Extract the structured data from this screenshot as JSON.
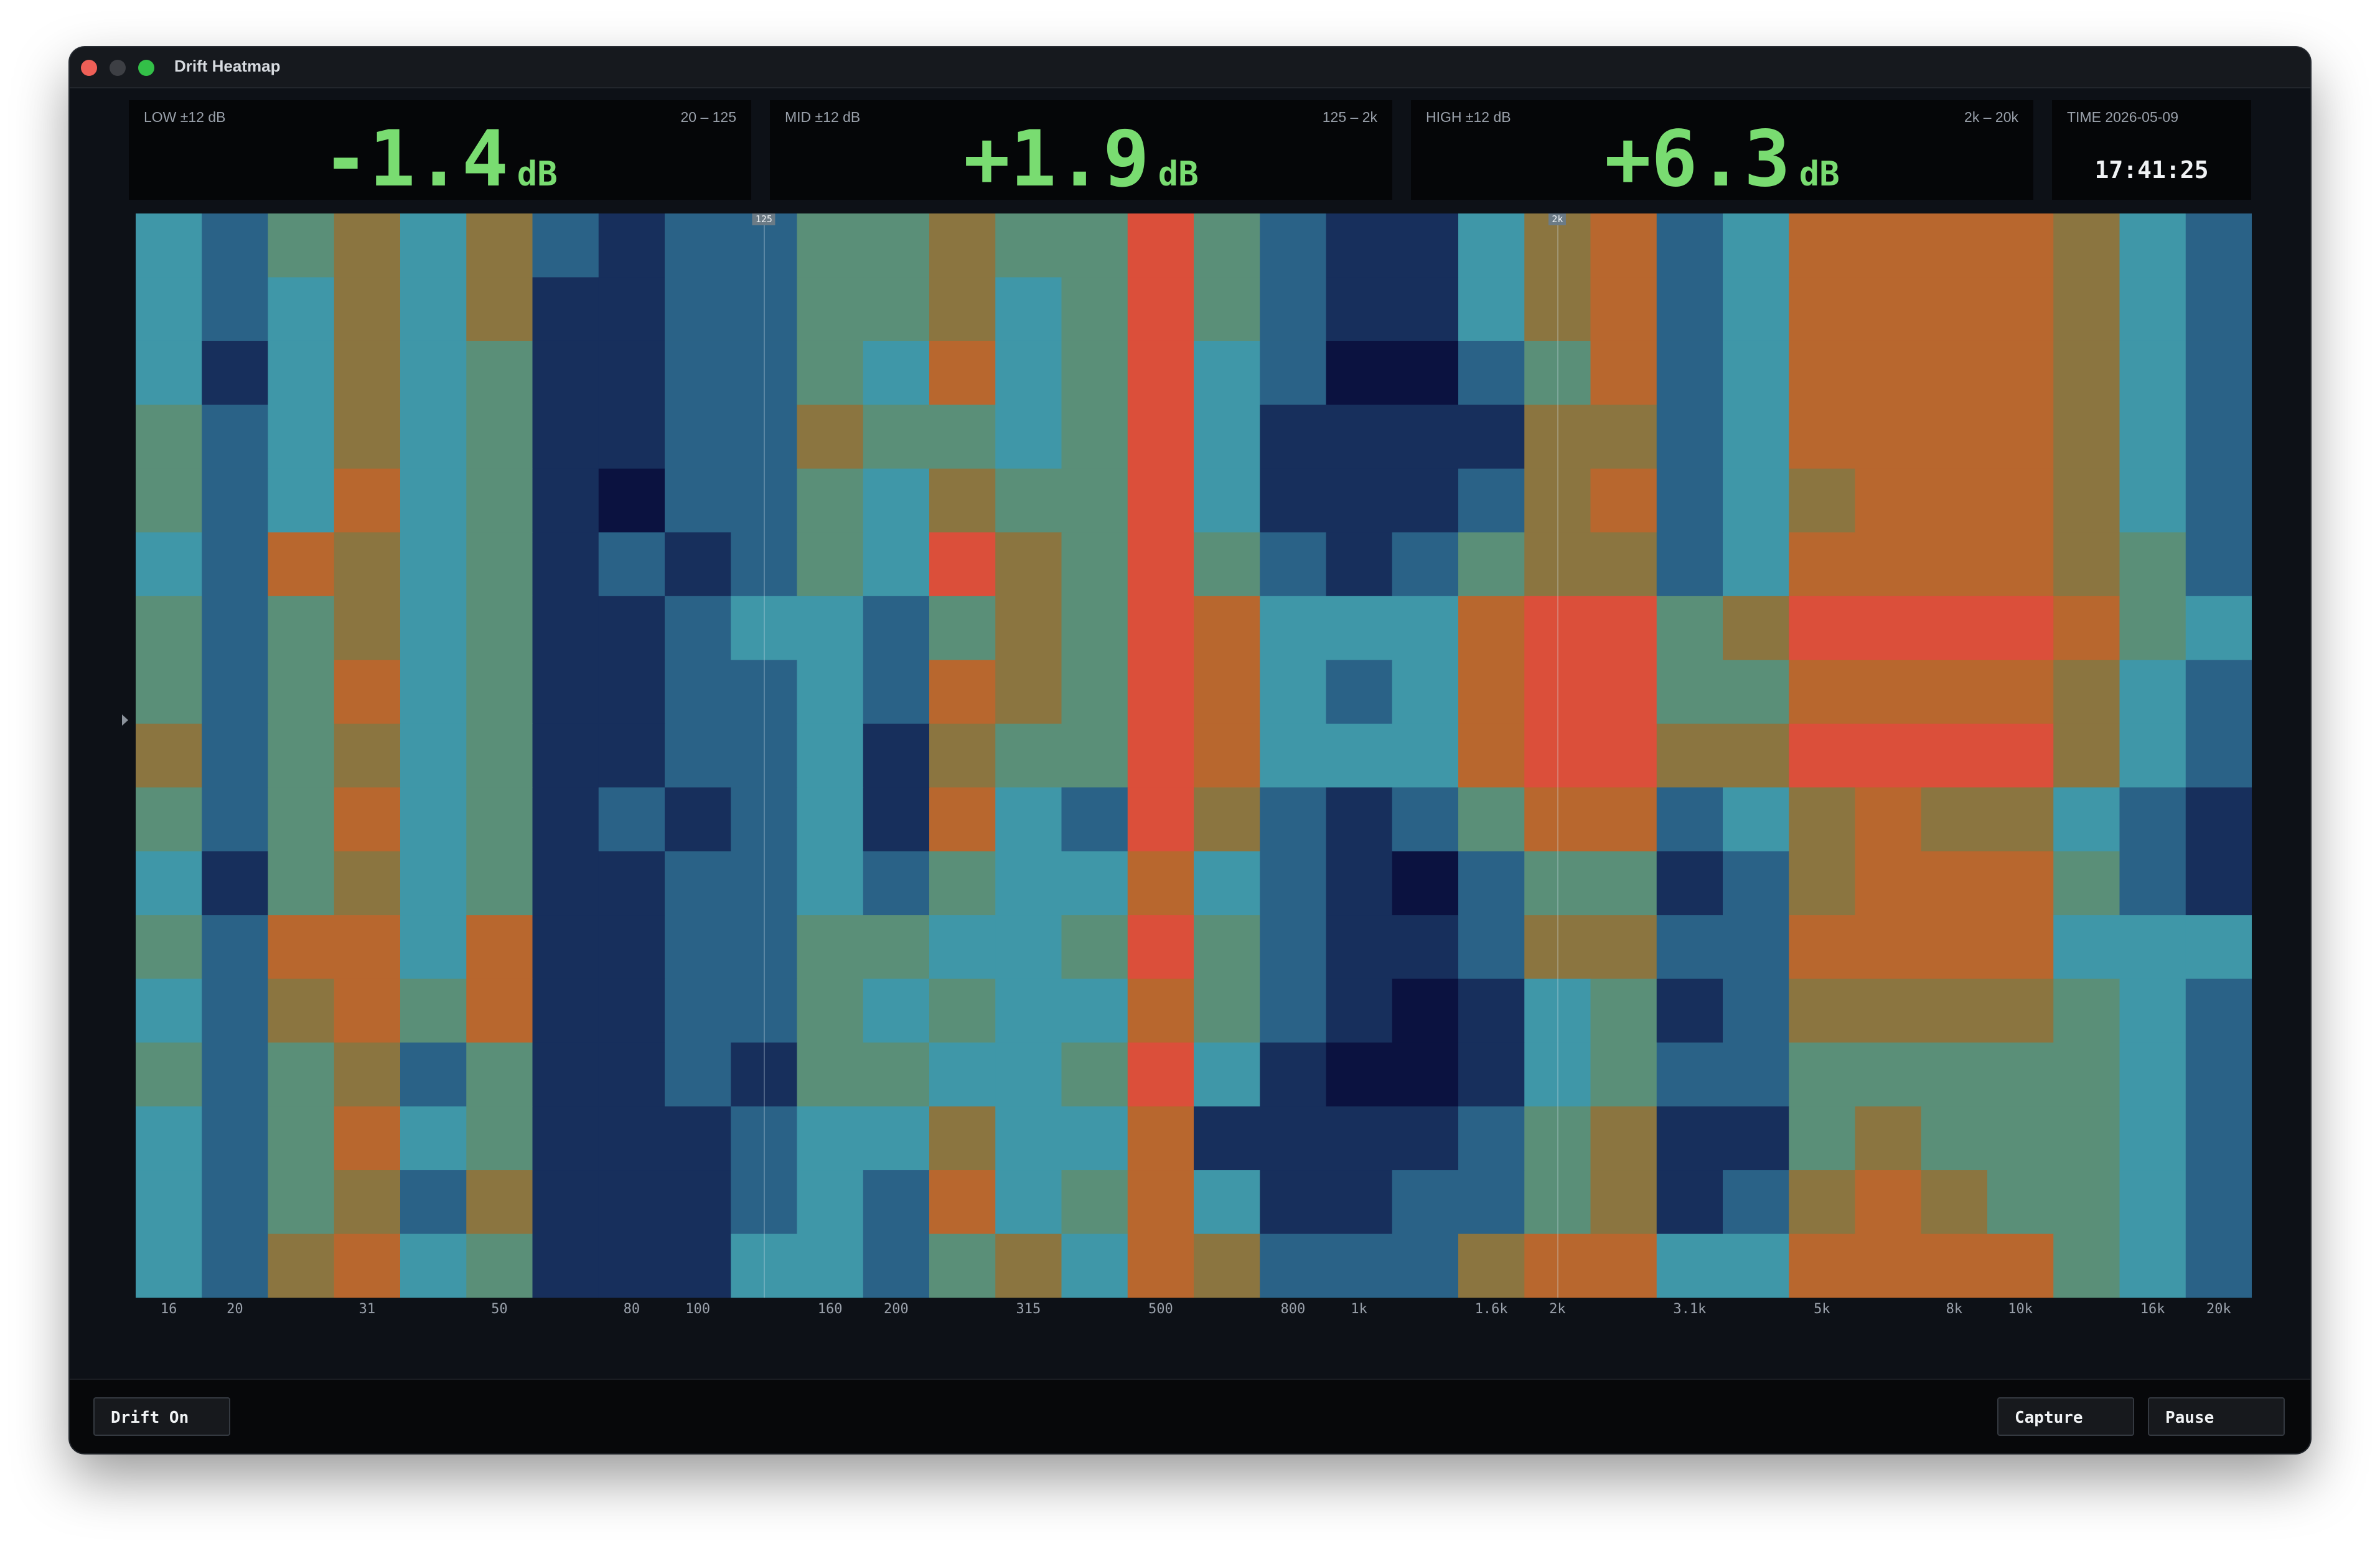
{
  "window": {
    "title": "Drift Heatmap"
  },
  "meters": [
    {
      "label": "LOW  ±12 dB",
      "range": "20 – 125",
      "value": "-1.4",
      "unit": "dB"
    },
    {
      "label": "MID  ±12 dB",
      "range": "125 – 2k",
      "value": "+1.9",
      "unit": "dB"
    },
    {
      "label": "HIGH  ±12 dB",
      "range": "2k – 20k",
      "value": "+6.3",
      "unit": "dB"
    }
  ],
  "time": {
    "label": "TIME  2026-05-09",
    "value": "17:41:25"
  },
  "heatmap": {
    "columns": 32,
    "rows": 17,
    "band_markers": [
      "125",
      "2k"
    ],
    "x_tick_labels": [
      "16",
      "20",
      "",
      "31",
      "",
      "50",
      "",
      "80",
      "100",
      "",
      "160",
      "200",
      "",
      "315",
      "",
      "500",
      "",
      "800",
      "1k",
      "",
      "1.6k",
      "2k",
      "",
      "3.1k",
      "",
      "5k",
      "",
      "8k",
      "10k",
      "",
      "16k",
      "20k"
    ],
    "colormap": [
      "#0b1240",
      "#172f5c",
      "#2a6287",
      "#3f97a8",
      "#5a8f78",
      "#8b7540",
      "#b8672e",
      "#db4f3a"
    ],
    "cells": [
      [
        3,
        2,
        4,
        5,
        3,
        5,
        2,
        1,
        2,
        2,
        4,
        4,
        5,
        4,
        4,
        7,
        4,
        2,
        1,
        1,
        3,
        5,
        6,
        2,
        3,
        6,
        6,
        6,
        6,
        5,
        3,
        2
      ],
      [
        3,
        2,
        3,
        5,
        3,
        5,
        1,
        1,
        2,
        2,
        4,
        4,
        5,
        3,
        4,
        7,
        4,
        2,
        1,
        1,
        3,
        5,
        6,
        2,
        3,
        6,
        6,
        6,
        6,
        5,
        3,
        2
      ],
      [
        3,
        1,
        3,
        5,
        3,
        4,
        1,
        1,
        2,
        2,
        4,
        3,
        6,
        3,
        4,
        7,
        3,
        2,
        0,
        0,
        2,
        4,
        6,
        2,
        3,
        6,
        6,
        6,
        6,
        5,
        3,
        2
      ],
      [
        4,
        2,
        3,
        5,
        3,
        4,
        1,
        1,
        2,
        2,
        5,
        4,
        4,
        3,
        4,
        7,
        3,
        1,
        1,
        1,
        1,
        5,
        5,
        2,
        3,
        6,
        6,
        6,
        6,
        5,
        3,
        2
      ],
      [
        4,
        2,
        3,
        6,
        3,
        4,
        1,
        0,
        2,
        2,
        4,
        3,
        5,
        4,
        4,
        7,
        3,
        1,
        1,
        1,
        2,
        5,
        6,
        2,
        3,
        5,
        6,
        6,
        6,
        5,
        3,
        2
      ],
      [
        3,
        2,
        6,
        5,
        3,
        4,
        1,
        2,
        1,
        2,
        4,
        3,
        7,
        5,
        4,
        7,
        4,
        2,
        1,
        2,
        4,
        5,
        5,
        2,
        3,
        6,
        6,
        6,
        6,
        5,
        4,
        2
      ],
      [
        4,
        2,
        4,
        5,
        3,
        4,
        1,
        1,
        2,
        3,
        3,
        2,
        4,
        5,
        4,
        7,
        6,
        3,
        3,
        3,
        6,
        7,
        7,
        4,
        5,
        7,
        7,
        7,
        7,
        6,
        4,
        3
      ],
      [
        4,
        2,
        4,
        6,
        3,
        4,
        1,
        1,
        2,
        2,
        3,
        2,
        6,
        5,
        4,
        7,
        6,
        3,
        2,
        3,
        6,
        7,
        7,
        4,
        4,
        6,
        6,
        6,
        6,
        5,
        3,
        2
      ],
      [
        5,
        2,
        4,
        5,
        3,
        4,
        1,
        1,
        2,
        2,
        3,
        1,
        5,
        4,
        4,
        7,
        6,
        3,
        3,
        3,
        6,
        7,
        7,
        5,
        5,
        7,
        7,
        7,
        7,
        5,
        3,
        2
      ],
      [
        4,
        2,
        4,
        6,
        3,
        4,
        1,
        2,
        1,
        2,
        3,
        1,
        6,
        3,
        2,
        7,
        5,
        2,
        1,
        2,
        4,
        6,
        6,
        2,
        3,
        5,
        6,
        5,
        5,
        3,
        2,
        1
      ],
      [
        3,
        1,
        4,
        5,
        3,
        4,
        1,
        1,
        2,
        2,
        3,
        2,
        4,
        3,
        3,
        6,
        3,
        2,
        1,
        0,
        2,
        4,
        4,
        1,
        2,
        5,
        6,
        6,
        6,
        4,
        2,
        1
      ],
      [
        4,
        2,
        6,
        6,
        3,
        6,
        1,
        1,
        2,
        2,
        4,
        4,
        3,
        3,
        4,
        7,
        4,
        2,
        1,
        1,
        2,
        5,
        5,
        2,
        2,
        6,
        6,
        6,
        6,
        3,
        3,
        3
      ],
      [
        3,
        2,
        5,
        6,
        4,
        6,
        1,
        1,
        2,
        2,
        4,
        3,
        4,
        3,
        3,
        6,
        4,
        2,
        1,
        0,
        1,
        3,
        4,
        1,
        2,
        5,
        5,
        5,
        5,
        4,
        3,
        2
      ],
      [
        4,
        2,
        4,
        5,
        2,
        4,
        1,
        1,
        2,
        1,
        4,
        4,
        3,
        3,
        4,
        7,
        3,
        1,
        0,
        0,
        1,
        3,
        4,
        2,
        2,
        4,
        4,
        4,
        4,
        4,
        3,
        2
      ],
      [
        3,
        2,
        4,
        6,
        3,
        4,
        1,
        1,
        1,
        2,
        3,
        3,
        5,
        3,
        3,
        6,
        1,
        1,
        1,
        1,
        2,
        4,
        5,
        1,
        1,
        4,
        5,
        4,
        4,
        4,
        3,
        2
      ],
      [
        3,
        2,
        4,
        5,
        2,
        5,
        1,
        1,
        1,
        2,
        3,
        2,
        6,
        3,
        4,
        6,
        3,
        1,
        1,
        2,
        2,
        4,
        5,
        1,
        2,
        5,
        6,
        5,
        4,
        4,
        3,
        2
      ],
      [
        3,
        2,
        5,
        6,
        3,
        4,
        1,
        1,
        1,
        3,
        3,
        2,
        4,
        5,
        3,
        6,
        5,
        2,
        2,
        2,
        5,
        6,
        6,
        3,
        3,
        6,
        6,
        6,
        6,
        4,
        3,
        2
      ]
    ]
  },
  "footer": {
    "drift_label": "Drift On",
    "capture_label": "Capture",
    "pause_label": "Pause"
  }
}
